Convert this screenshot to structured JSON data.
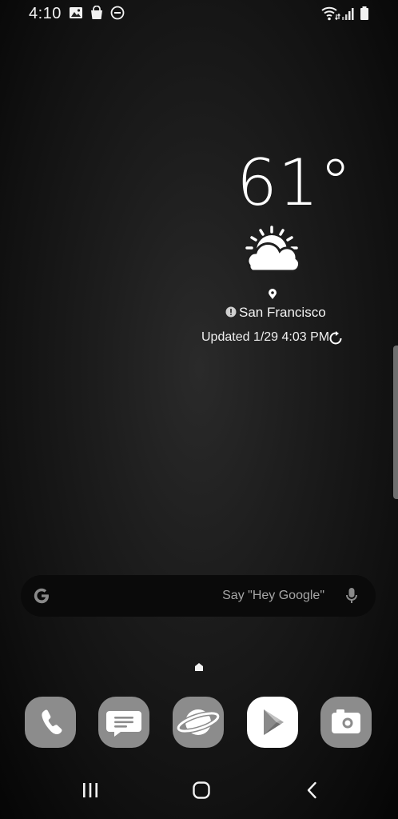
{
  "status_bar": {
    "time": "4:10",
    "left_icons": [
      "gallery-icon",
      "shopping-bag-icon",
      "do-not-disturb-icon"
    ],
    "right_icons": [
      "wifi-icon",
      "cellular-signal-icon",
      "battery-icon"
    ]
  },
  "weather": {
    "temperature": "61°",
    "condition_icon": "partly-sunny-icon",
    "location": "San Francisco",
    "updated": "Updated 1/29 4:03 PM"
  },
  "search": {
    "placeholder": "Say \"Hey Google\"",
    "logo": "google-g-icon",
    "mic": "microphone-icon"
  },
  "dock": [
    {
      "name": "phone",
      "icon": "phone-icon"
    },
    {
      "name": "messages",
      "icon": "messages-icon"
    },
    {
      "name": "internet",
      "icon": "planet-browser-icon"
    },
    {
      "name": "play-store",
      "icon": "play-store-icon"
    },
    {
      "name": "camera",
      "icon": "camera-icon"
    }
  ],
  "nav_bar": [
    "recents-button",
    "home-button",
    "back-button"
  ],
  "colors": {
    "background": "#1d1d1d",
    "search_bar": "#0a0a0a",
    "app_tile": "#8a8a8a",
    "placeholder_text": "#a6a6a6"
  }
}
